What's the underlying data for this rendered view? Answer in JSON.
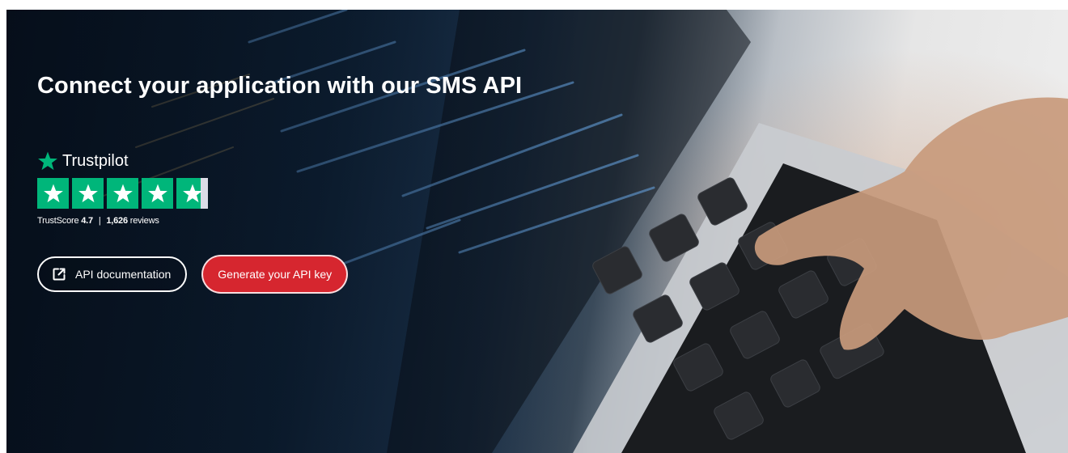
{
  "hero": {
    "title": "Connect your application with our SMS API",
    "background_image": "laptop-keyboard-code-photo"
  },
  "trustpilot": {
    "brand": "Trustpilot",
    "brand_color": "#00b67a",
    "rating_stars": 4.5,
    "max_stars": 5,
    "trustscore_label": "TrustScore",
    "trustscore_value": "4.7",
    "separator": "|",
    "reviews_count": "1,626",
    "reviews_label": "reviews"
  },
  "buttons": {
    "api_docs_label": "API documentation",
    "api_docs_icon": "external-link-icon",
    "generate_key_label": "Generate your API key",
    "generate_key_color": "#d6262f"
  }
}
